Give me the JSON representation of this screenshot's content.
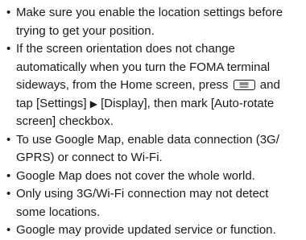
{
  "notes": [
    {
      "lines": [
        "Make sure you enable the location settings before",
        "trying to get your position."
      ]
    },
    {
      "lines": [
        "If the screen orientation does not change",
        "automatically when you turn the FOMA terminal"
      ],
      "line3_a": "sideways, from the Home screen, press",
      "line3_b": "and",
      "line4_a": "tap [Settings]",
      "line4_b": "[Display], then mark [Auto-rotate",
      "line5": "screen] checkbox."
    },
    {
      "lines": [
        "To use Google Map, enable data connection (3G/",
        "GPRS) or connect to Wi-Fi."
      ]
    },
    {
      "lines": [
        "Google Map does not cover the whole world."
      ]
    },
    {
      "lines": [
        "Only using 3G/Wi-Fi connection may not detect",
        "some locations."
      ]
    },
    {
      "lines": [
        "Google may provide updated service or function."
      ]
    }
  ],
  "icons": {
    "menu_key": "menu-key-icon",
    "arrow": "triangle-right-icon"
  }
}
